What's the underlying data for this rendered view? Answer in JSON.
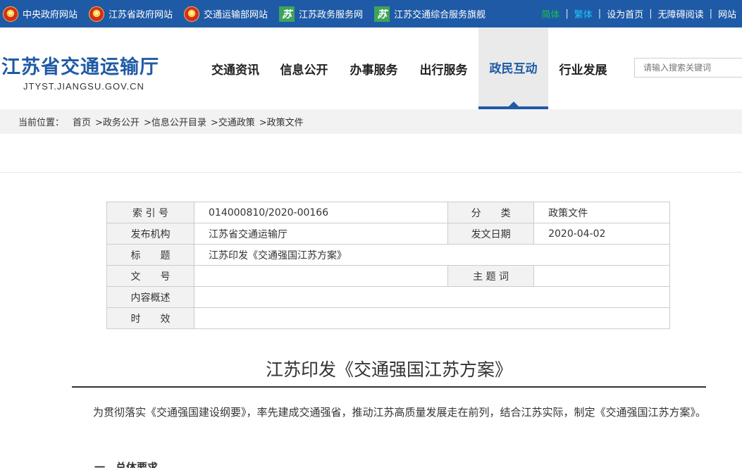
{
  "topbar": {
    "links": [
      {
        "label": "中央政府网站",
        "icon": "national-emblem-icon"
      },
      {
        "label": "江苏省政府网站",
        "icon": "national-emblem-icon"
      },
      {
        "label": "交通运输部网站",
        "icon": "national-emblem-icon"
      },
      {
        "label": "江苏政务服务网",
        "icon": "su-logo-icon"
      },
      {
        "label": "江苏交通综合服务旗舰",
        "icon": "su-logo-icon"
      }
    ],
    "right": {
      "simplified": "简体",
      "traditional": "繁体",
      "homepage": "设为首页",
      "accessible": "无障碍阅读",
      "more": "网站"
    },
    "separator": "|",
    "colors": {
      "bar": "#1f5aa6",
      "simplified": "#19c24b",
      "traditional": "#1dc5ff"
    }
  },
  "header": {
    "logo_cn": "江苏省交通运输厅",
    "logo_en": "JTYST.JIANGSU.GOV.CN",
    "nav": [
      "交通资讯",
      "信息公开",
      "办事服务",
      "出行服务",
      "政民互动",
      "行业发展"
    ],
    "active_nav": "政民互动",
    "search_placeholder": "请输入搜索关键词"
  },
  "breadcrumb": {
    "label": "当前位置：",
    "items": [
      "首页",
      ">政务公开",
      ">信息公开目录",
      ">交通政策",
      ">政策文件"
    ]
  },
  "info_table": {
    "index_label": "索 引 号",
    "index_value": "014000810/2020-00166",
    "category_label": "分　　类",
    "category_value": "政策文件",
    "issuer_label": "发布机构",
    "issuer_value": "江苏省交通运输厅",
    "date_label": "发文日期",
    "date_value": "2020-04-02",
    "title_label": "标　　题",
    "title_value": "江苏印发《交通强国江苏方案》",
    "docno_label": "文　　号",
    "docno_value": "",
    "keywords_label": "主 题 词",
    "keywords_value": "",
    "summary_label": "内容概述",
    "summary_value": "",
    "validity_label": "时　　效",
    "validity_value": ""
  },
  "article": {
    "title": "江苏印发《交通强国江苏方案》",
    "paragraph": "为贯彻落实《交通强国建设纲要》，率先建成交通强省，推动江苏高质量发展走在前列，结合江苏实际，制定《交通强国江苏方案》。",
    "section_heading": "一、总体要求"
  }
}
